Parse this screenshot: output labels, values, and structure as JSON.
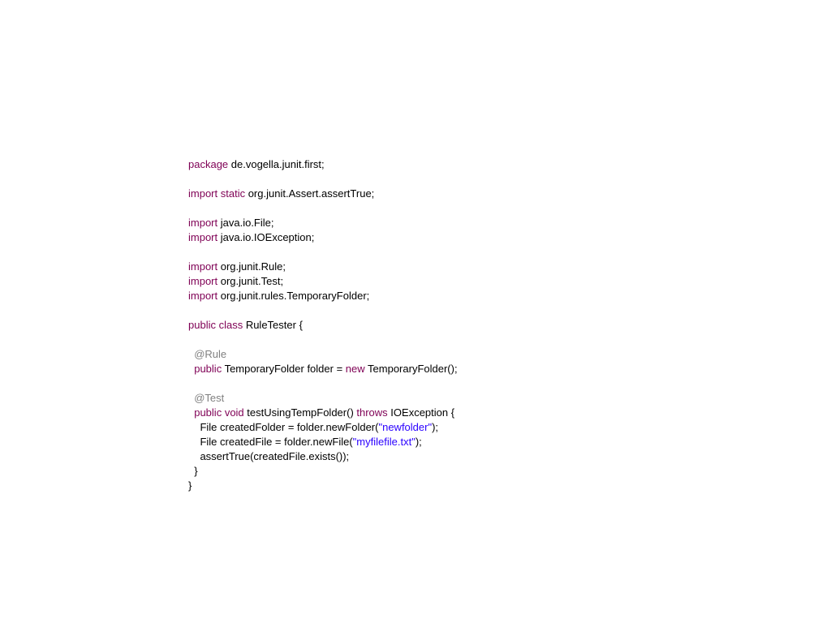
{
  "code": {
    "kw_package": "package",
    "pkg_name": " de.vogella.junit.first;",
    "kw_import1": "import",
    "kw_static": " static",
    "imp1_rest": " org.junit.Assert.assertTrue;",
    "kw_import2": "import",
    "imp2_rest": " java.io.File;",
    "kw_import3": "import",
    "imp3_rest": " java.io.IOException;",
    "kw_import4": "import",
    "imp4_rest": " org.junit.Rule;",
    "kw_import5": "import",
    "imp5_rest": " org.junit.Test;",
    "kw_import6": "import",
    "imp6_rest": " org.junit.rules.TemporaryFolder;",
    "kw_public1": "public",
    "kw_class": " class",
    "class_decl": " RuleTester {",
    "ann_rule": "  @Rule",
    "kw_public2": "  public",
    "field_decl1": " TemporaryFolder folder = ",
    "kw_new": "new",
    "field_decl2": " TemporaryFolder();",
    "ann_test": "  @Test",
    "kw_public3": "  public",
    "kw_void": " void",
    "method_name": " testUsingTempFolder() ",
    "kw_throws": "throws",
    "method_throws": " IOException {",
    "stmt1_a": "    File createdFolder = folder.newFolder(",
    "str1": "\"newfolder\"",
    "stmt1_b": ");",
    "stmt2_a": "    File createdFile = folder.newFile(",
    "str2": "\"myfilefile.txt\"",
    "stmt2_b": ");",
    "stmt3": "    assertTrue(createdFile.exists());",
    "close_method": "  }",
    "close_class": "} "
  }
}
